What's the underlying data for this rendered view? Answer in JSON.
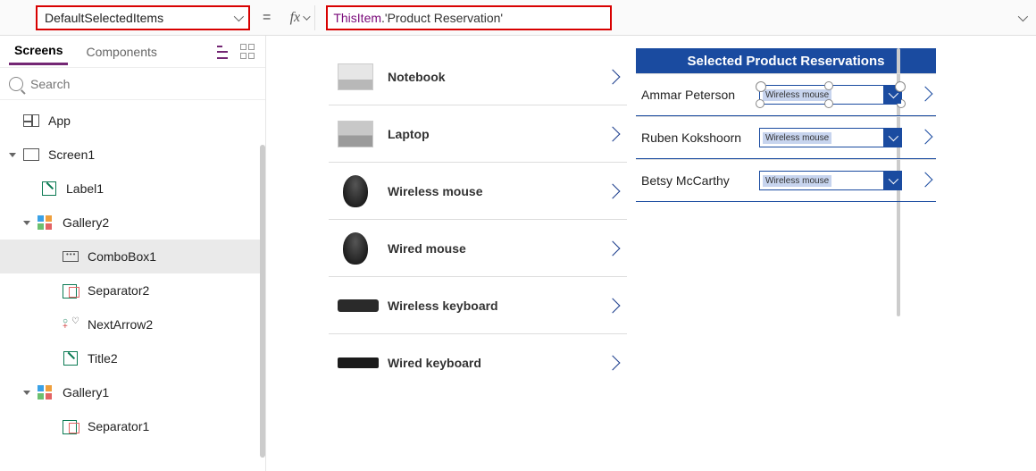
{
  "property_selector": {
    "value": "DefaultSelectedItems"
  },
  "formula_bar": {
    "equals": "=",
    "fx": "fx",
    "formula_prop": "ThisItem",
    "formula_rest": ".'Product Reservation'"
  },
  "tabs": {
    "screens": "Screens",
    "components": "Components"
  },
  "search": {
    "placeholder": "Search"
  },
  "tree": {
    "app": "App",
    "screen1": "Screen1",
    "label1": "Label1",
    "gallery2": "Gallery2",
    "combobox1": "ComboBox1",
    "separator2": "Separator2",
    "nextarrow2": "NextArrow2",
    "title2": "Title2",
    "gallery1": "Gallery1",
    "separator1": "Separator1"
  },
  "products": [
    {
      "name": "Notebook",
      "img": "notebook"
    },
    {
      "name": "Laptop",
      "img": "laptop"
    },
    {
      "name": "Wireless mouse",
      "img": "mouse"
    },
    {
      "name": "Wired mouse",
      "img": "mouse"
    },
    {
      "name": "Wireless keyboard",
      "img": "kbwl"
    },
    {
      "name": "Wired keyboard",
      "img": "kbw"
    }
  ],
  "reservations": {
    "header": "Selected Product Reservations",
    "rows": [
      {
        "name": "Ammar Peterson",
        "value": "Wireless mouse",
        "selected": true
      },
      {
        "name": "Ruben Kokshoorn",
        "value": "Wireless mouse",
        "selected": false
      },
      {
        "name": "Betsy McCarthy",
        "value": "Wireless mouse",
        "selected": false
      }
    ]
  }
}
